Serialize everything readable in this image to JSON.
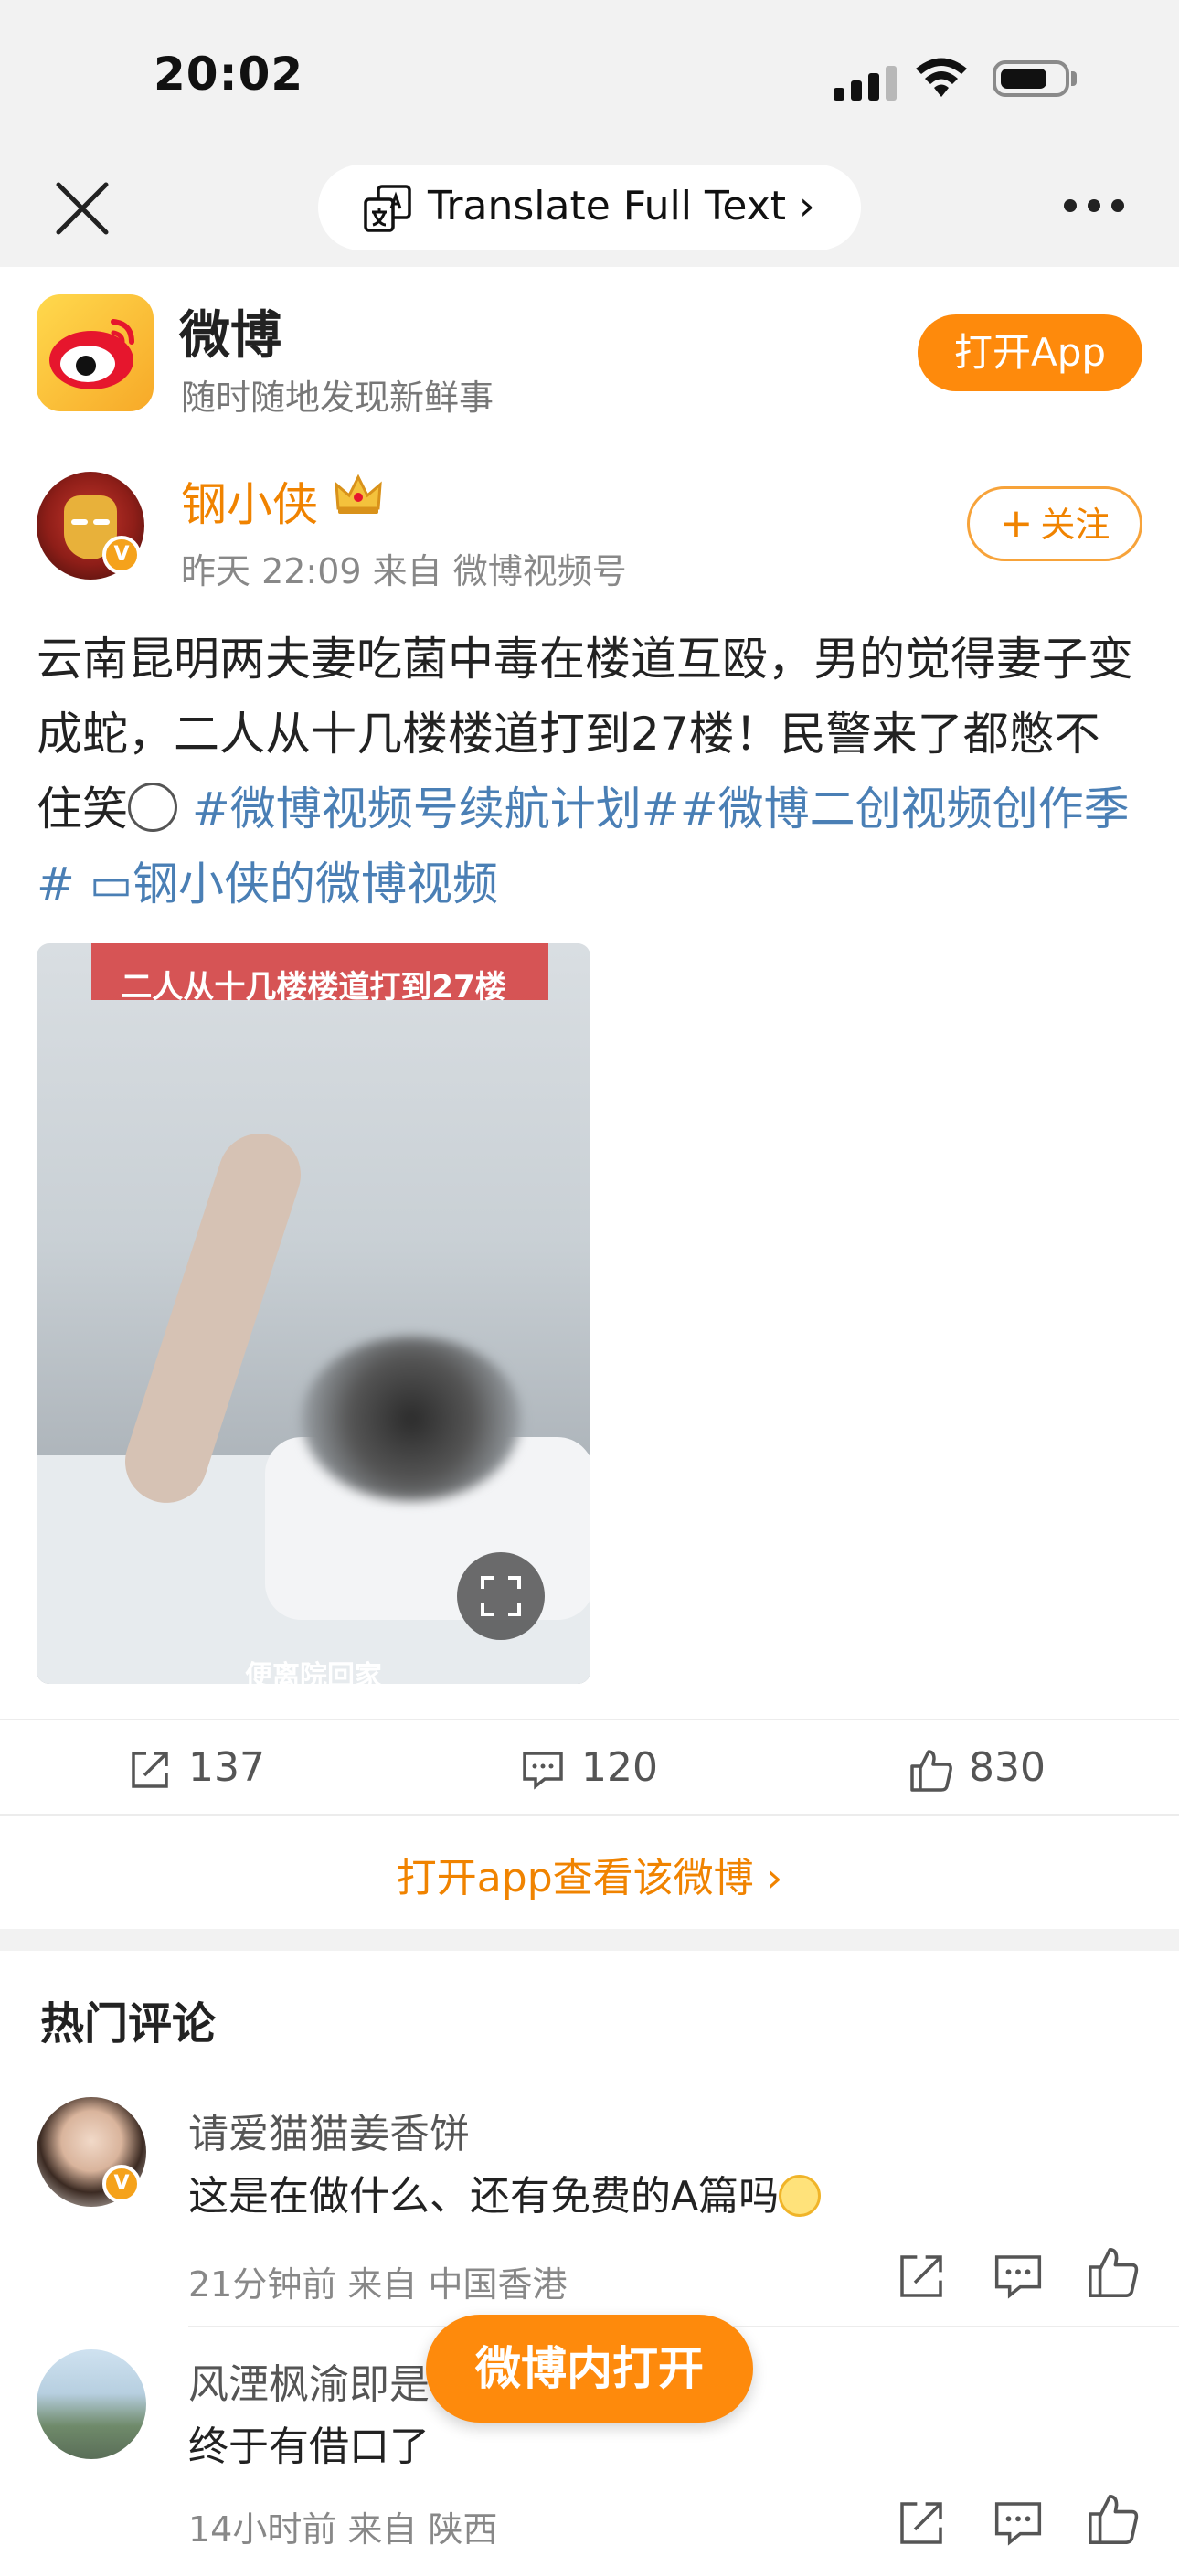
{
  "status_bar": {
    "time": "20:02"
  },
  "top_bar": {
    "translate_label": "Translate Full Text ›"
  },
  "app_banner": {
    "name": "微博",
    "tagline": "随时随地发现新鲜事",
    "open_button": "打开App"
  },
  "post": {
    "author": "钢小侠",
    "meta": "昨天 22:09  来自 微博视频号",
    "follow_label": "关注",
    "text_plain": "云南昆明两夫妻吃菌中毒在楼道互殴，男的觉得妻子变成蛇，二人从十几楼楼道打到27楼！民警来了都憋不住笑",
    "hashtags": "#微博视频号续航计划##微博二创视频创作季#",
    "video_link": "钢小侠的微博视频",
    "video": {
      "caption_top": "二人从十几楼楼道打到27楼",
      "caption_bottom": "便离院回家"
    },
    "actions": {
      "reposts": "137",
      "comments": "120",
      "likes": "830"
    },
    "open_in_app": "打开app查看该微博 ›"
  },
  "comments_section": {
    "title": "热门评论",
    "comments": [
      {
        "name": "请爱猫猫姜香饼",
        "text": "这是在做什么、还有免费的A篇吗",
        "meta": "21分钟前  来自 中国香港"
      },
      {
        "name": "风湮枫渝即是",
        "text": "终于有借口了",
        "meta": "14小时前  来自 陕西"
      }
    ]
  },
  "floating_button": "微博内打开",
  "colors": {
    "accent": "#fe8a0c",
    "link": "#4a7fb5",
    "author": "#f08300"
  }
}
